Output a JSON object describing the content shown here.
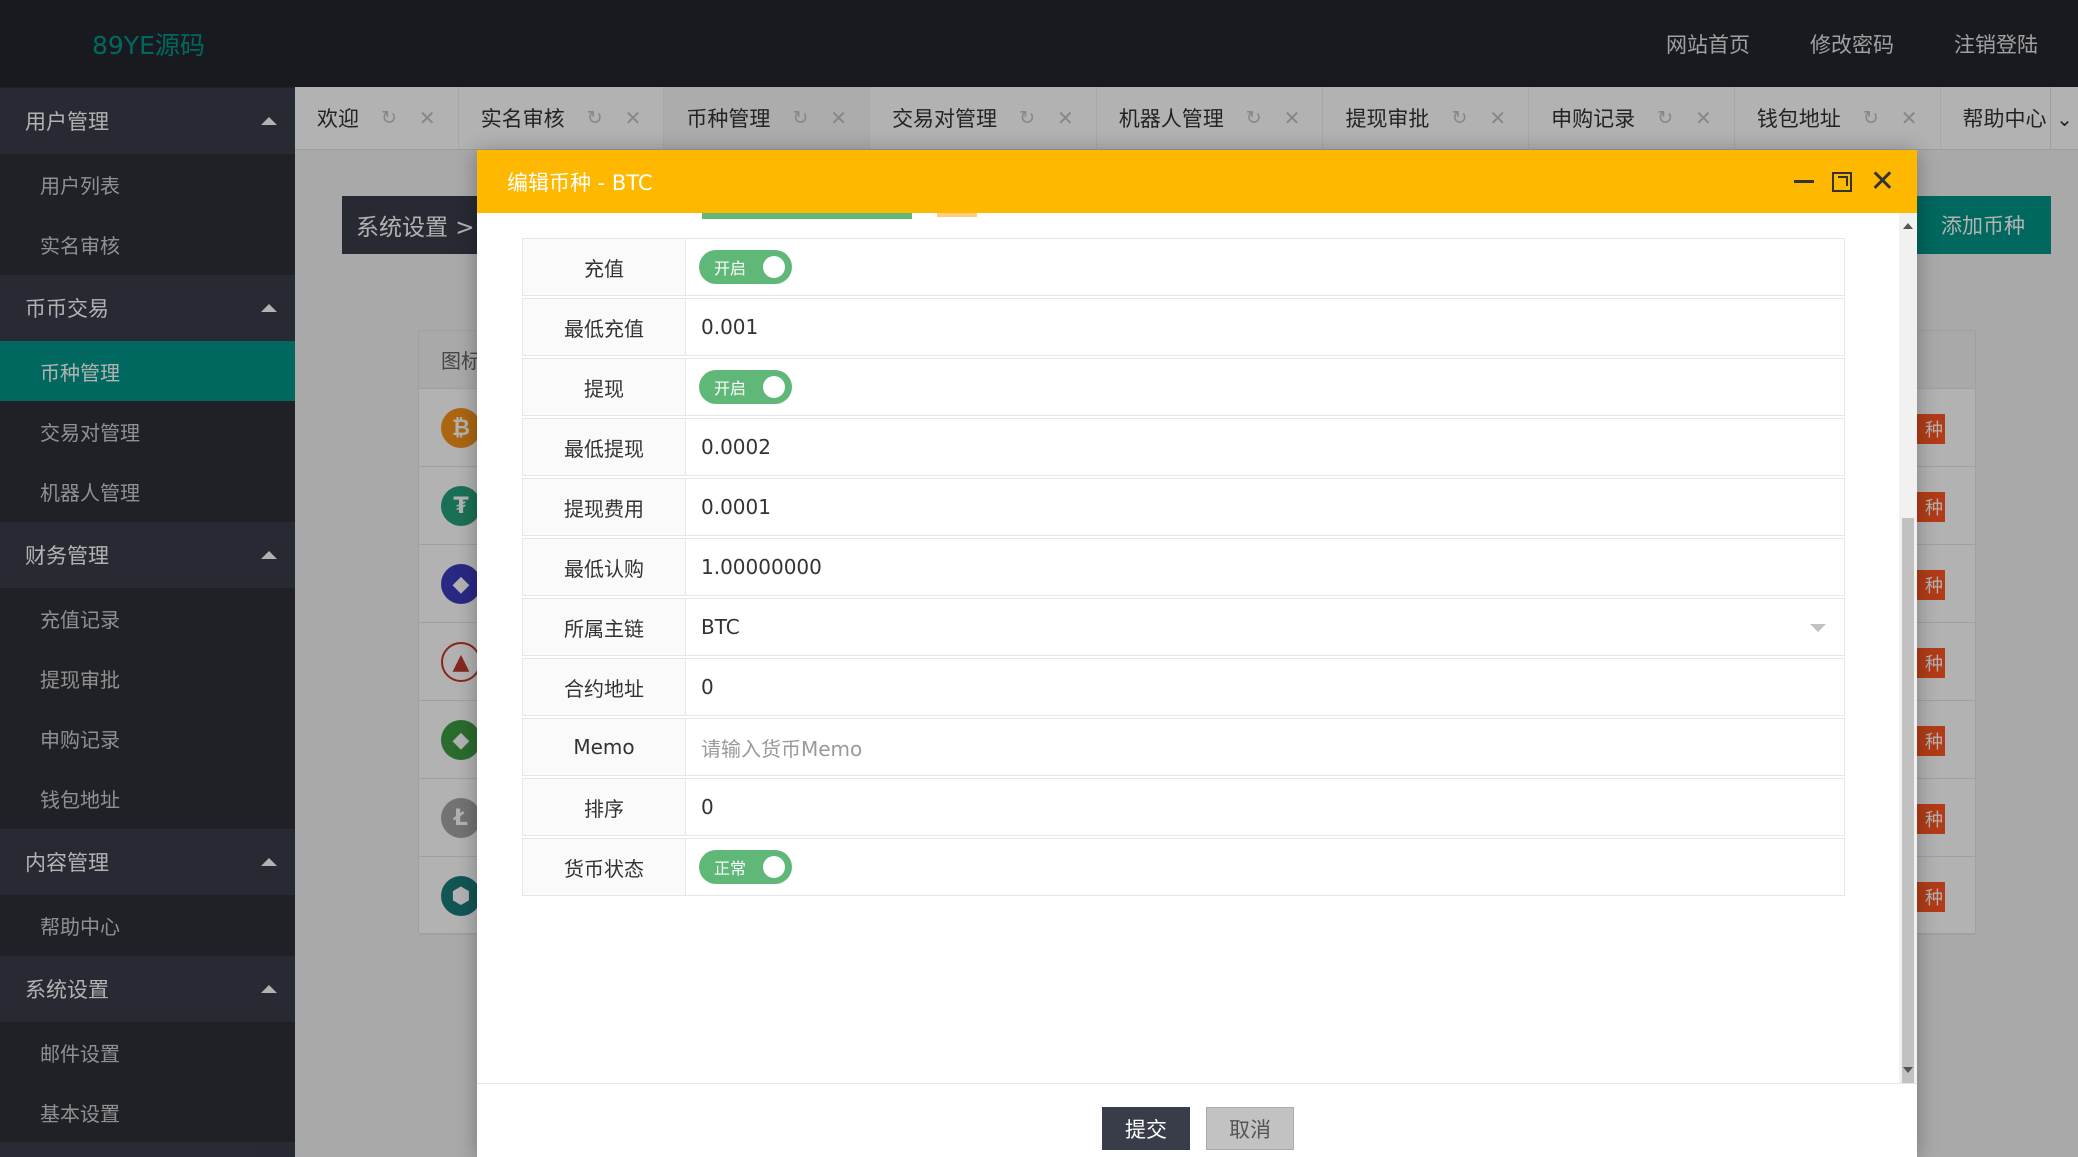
{
  "app": {
    "logo": "89YE源码",
    "top_links": [
      "网站首页",
      "修改密码",
      "注销登陆"
    ]
  },
  "sidebar": {
    "groups": [
      {
        "title": "用户管理",
        "items": [
          {
            "label": "用户列表",
            "active": false
          },
          {
            "label": "实名审核",
            "active": false
          }
        ]
      },
      {
        "title": "币币交易",
        "items": [
          {
            "label": "币种管理",
            "active": true
          },
          {
            "label": "交易对管理",
            "active": false
          },
          {
            "label": "机器人管理",
            "active": false
          }
        ]
      },
      {
        "title": "财务管理",
        "items": [
          {
            "label": "充值记录",
            "active": false
          },
          {
            "label": "提现审批",
            "active": false
          },
          {
            "label": "申购记录",
            "active": false
          },
          {
            "label": "钱包地址",
            "active": false
          }
        ]
      },
      {
        "title": "内容管理",
        "items": [
          {
            "label": "帮助中心",
            "active": false
          }
        ]
      },
      {
        "title": "系统设置",
        "items": [
          {
            "label": "邮件设置",
            "active": false
          },
          {
            "label": "基本设置",
            "active": false
          }
        ]
      }
    ]
  },
  "tabs": [
    {
      "label": "欢迎",
      "active": false
    },
    {
      "label": "实名审核",
      "active": false
    },
    {
      "label": "币种管理",
      "active": true
    },
    {
      "label": "交易对管理",
      "active": false
    },
    {
      "label": "机器人管理",
      "active": false
    },
    {
      "label": "提现审批",
      "active": false
    },
    {
      "label": "申购记录",
      "active": false
    },
    {
      "label": "钱包地址",
      "active": false
    },
    {
      "label": "帮助中心",
      "active": false
    }
  ],
  "background": {
    "breadcrumb": "系统设置 >",
    "add_button": "添加币种",
    "table_header": "图标",
    "row_tag": "种",
    "coin_rows": [
      {
        "glyph": "₿",
        "color": "#f7931a"
      },
      {
        "glyph": "₮",
        "color": "#26a17b"
      },
      {
        "glyph": "◆",
        "color": "#3c3cbd"
      },
      {
        "glyph": "▲",
        "color": "#ffffff"
      },
      {
        "glyph": "◆",
        "color": "#3d9b41"
      },
      {
        "glyph": "Ł",
        "color": "#a5a5a5"
      },
      {
        "glyph": "⬢",
        "color": "#1b7a7a"
      }
    ]
  },
  "modal": {
    "title": "编辑币种 - BTC",
    "fields": {
      "deposit": {
        "label": "充值",
        "switch": "开启"
      },
      "min_deposit": {
        "label": "最低充值",
        "value": "0.001"
      },
      "withdraw": {
        "label": "提现",
        "switch": "开启"
      },
      "min_withdraw": {
        "label": "最低提现",
        "value": "0.0002"
      },
      "withdraw_fee": {
        "label": "提现费用",
        "value": "0.0001"
      },
      "min_subscribe": {
        "label": "最低认购",
        "value": "1.00000000"
      },
      "main_chain": {
        "label": "所属主链",
        "value": "BTC"
      },
      "contract": {
        "label": "合约地址",
        "value": "0"
      },
      "memo": {
        "label": "Memo",
        "placeholder": "请输入货币Memo"
      },
      "sort": {
        "label": "排序",
        "value": "0"
      },
      "status": {
        "label": "货币状态",
        "switch": "正常"
      }
    },
    "submit": "提交",
    "cancel": "取消"
  },
  "colors": {
    "accent": "#009688",
    "modal_header": "#ffb800",
    "switch_on": "#5fb878",
    "tag": "#ff5722"
  }
}
